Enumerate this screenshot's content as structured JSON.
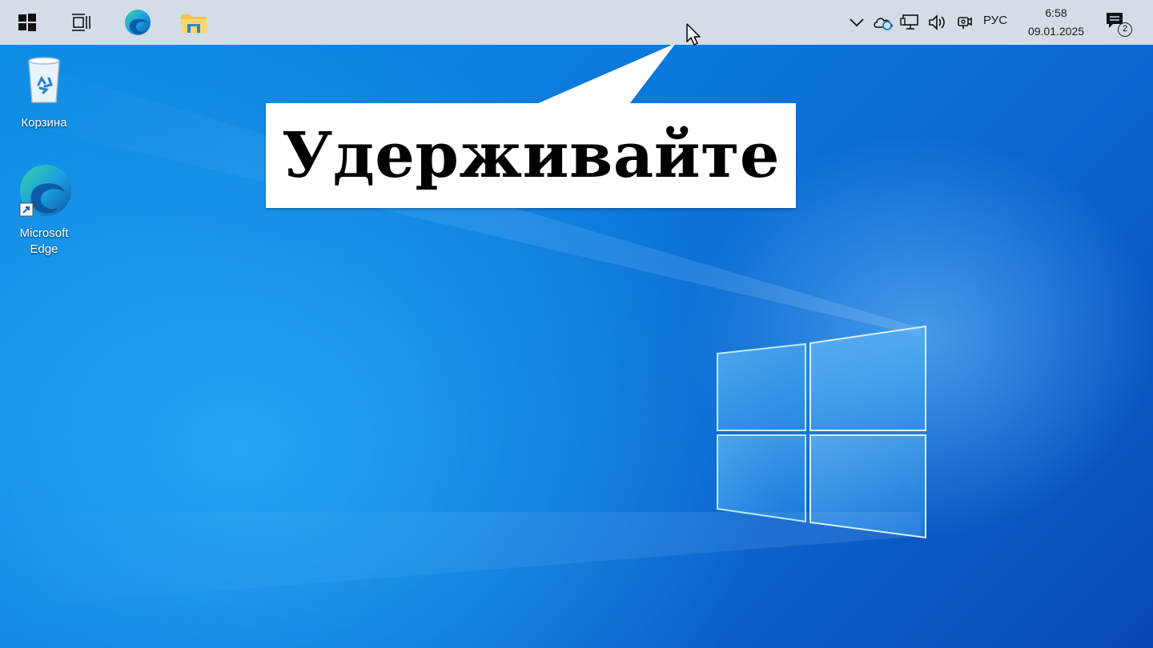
{
  "taskbar": {
    "start_icon": "windows-start-icon",
    "task_view_icon": "task-view-icon",
    "pinned_apps": [
      {
        "name": "Microsoft Edge",
        "icon": "edge-icon"
      },
      {
        "name": "File Explorer",
        "icon": "folder-icon"
      }
    ],
    "tray": {
      "icons": [
        "chevron-up-icon",
        "onedrive-sync-icon",
        "network-icon",
        "volume-icon",
        "meet-now-icon"
      ],
      "language": "РУС",
      "time": "6:58",
      "date": "09.01.2025",
      "notifications_count": "2"
    }
  },
  "desktop": {
    "icons": [
      {
        "label": "Корзина",
        "icon": "recycle-bin-icon"
      },
      {
        "label_line1": "Microsoft",
        "label_line2": "Edge",
        "icon": "edge-shortcut-icon"
      }
    ]
  },
  "callout": {
    "text": "Удерживайте"
  },
  "colors": {
    "taskbar_bg": "#d3dde7",
    "wallpaper": "#0b79dc",
    "callout_bg": "#ffffff"
  }
}
